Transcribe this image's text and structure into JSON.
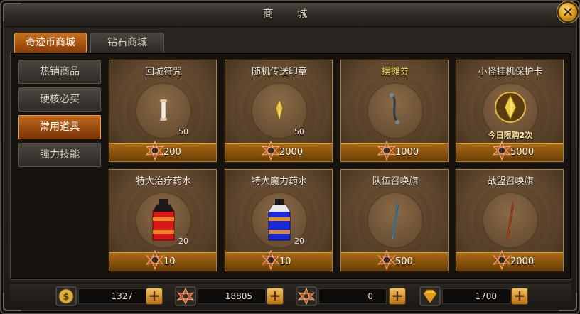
{
  "window": {
    "title": "商 城"
  },
  "tabs": [
    {
      "label": "奇迹币商城",
      "active": true
    },
    {
      "label": "钻石商城",
      "active": false
    }
  ],
  "sidebar": [
    {
      "label": "热销商品",
      "active": false
    },
    {
      "label": "硬核必买",
      "active": false
    },
    {
      "label": "常用道具",
      "active": true
    },
    {
      "label": "强力技能",
      "active": false
    }
  ],
  "items": [
    {
      "name": "回城符咒",
      "qty": "50",
      "price": "200",
      "icon": "scroll-icon",
      "name_color": "#f0e8da"
    },
    {
      "name": "随机传送印章",
      "qty": "50",
      "price": "2000",
      "icon": "seal-icon",
      "name_color": "#f0e8da"
    },
    {
      "name": "摆摊券",
      "qty": "",
      "price": "1000",
      "icon": "ticket-icon",
      "name_color": "#f5d35a"
    },
    {
      "name": "小怪挂机保护卡",
      "qty": "",
      "limit": "今日限购2次",
      "price": "5000",
      "icon": "gem-card-icon",
      "name_color": "#f0e8da"
    },
    {
      "name": "特大治疗药水",
      "qty": "20",
      "price": "10",
      "icon": "red-potion-icon",
      "name_color": "#f0e8da"
    },
    {
      "name": "特大魔力药水",
      "qty": "20",
      "price": "10",
      "icon": "blue-potion-icon",
      "name_color": "#f0e8da"
    },
    {
      "name": "队伍召唤旗",
      "qty": "",
      "price": "500",
      "icon": "team-banner-icon",
      "name_color": "#f0e8da"
    },
    {
      "name": "战盟召唤旗",
      "qty": "",
      "price": "2000",
      "icon": "guild-banner-icon",
      "name_color": "#f0e8da"
    }
  ],
  "currency": [
    {
      "icon": "gold-coin-icon",
      "value": "1327"
    },
    {
      "icon": "miracle-coin-icon",
      "value": "18805"
    },
    {
      "icon": "bound-miracle-coin-icon",
      "value": "0"
    },
    {
      "icon": "diamond-icon",
      "value": "1700"
    }
  ],
  "colors": {
    "accent_orange": "#c8701c",
    "price_bar": "#a86a12",
    "gold_text": "#f5d35a"
  }
}
